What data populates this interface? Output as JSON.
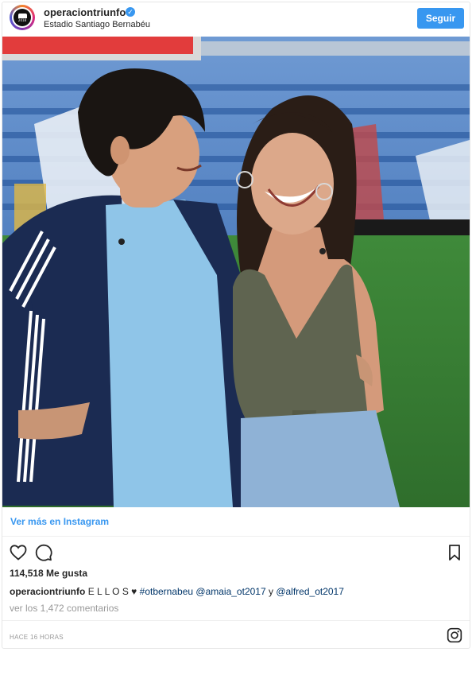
{
  "post": {
    "username": "operaciontriunfo",
    "location": "Estadio Santiago Bernabéu",
    "follow_label": "Seguir",
    "view_more": "Ver más en Instagram",
    "likes": "114,518 Me gusta",
    "caption": {
      "user": "operaciontriunfo",
      "text": "E L L O S",
      "hashtag": "#otbernabeu",
      "mention1": "@amaia_ot2017",
      "conjunction": "y",
      "mention2": "@alfred_ot2017"
    },
    "comments_link": "ver los 1,472 comentarios",
    "timestamp": "HACE 16 HORAS",
    "avatar_text": "2018"
  },
  "icons": {
    "verified": "verified-badge-icon",
    "like": "heart-icon",
    "comment": "comment-bubble-icon",
    "save": "bookmark-icon",
    "instagram": "instagram-logo-icon"
  },
  "colors": {
    "accent": "#3897f0",
    "link": "#003569",
    "muted": "#999999",
    "text": "#262626"
  }
}
